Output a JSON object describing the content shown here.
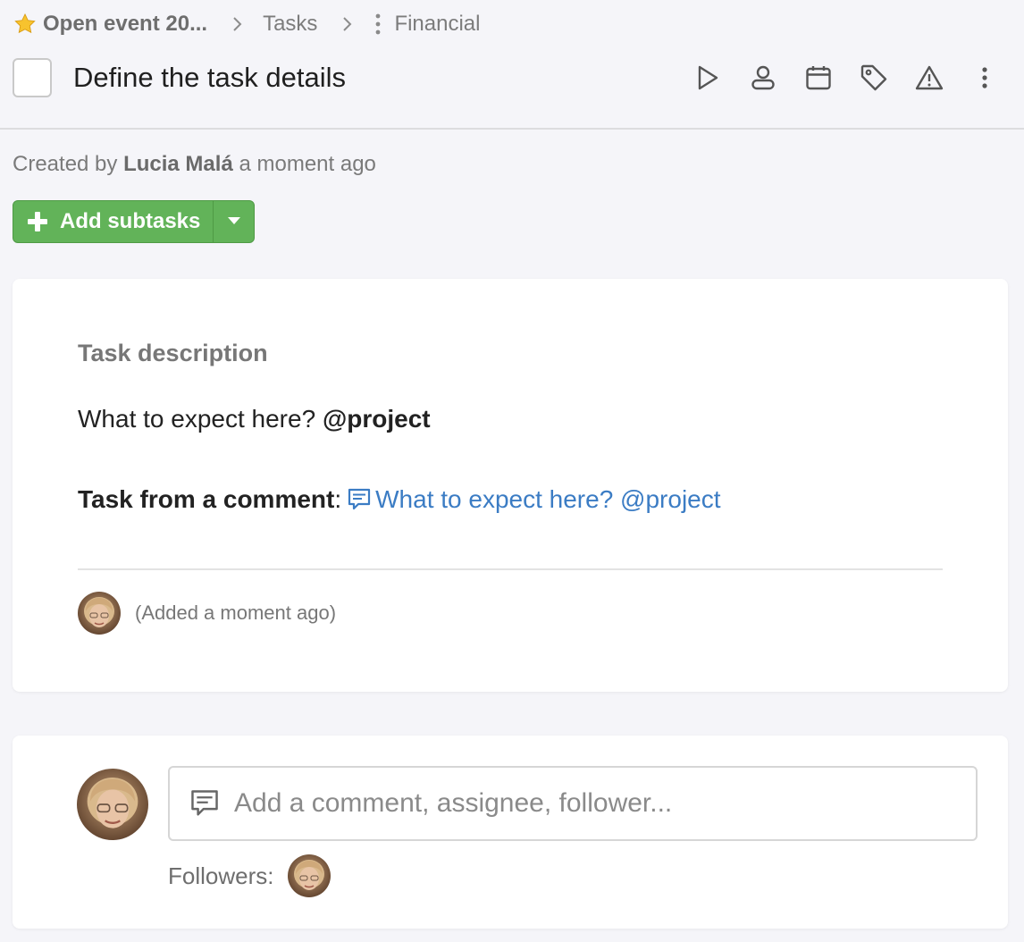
{
  "breadcrumb": {
    "project": "Open event 20...",
    "tasks": "Tasks",
    "list": "Financial",
    "star_icon": "star-icon",
    "separator_icon": "chevron-right-icon",
    "menu_icon": "vertical-dots-icon"
  },
  "task": {
    "title": "Define the task details",
    "checkbox_checked": false
  },
  "toolbar": {
    "items": [
      {
        "icon": "play-icon"
      },
      {
        "icon": "user-icon"
      },
      {
        "icon": "calendar-icon"
      },
      {
        "icon": "tag-icon"
      },
      {
        "icon": "warning-icon"
      },
      {
        "icon": "more-vertical-icon"
      }
    ]
  },
  "meta": {
    "prefix": "Created by",
    "author": "Lucia Malá",
    "suffix": "a moment ago"
  },
  "add_subtasks": {
    "label": "Add subtasks",
    "color": "#62b359"
  },
  "description": {
    "heading": "Task description",
    "line1_text": "What to expect here?",
    "line1_mention": "@project",
    "line2_label": "Task from a comment",
    "line2_colon": ":",
    "line2_link": "What to expect here? @project",
    "added_note": "(Added a moment ago)",
    "link_color": "#3b7cc4"
  },
  "comment": {
    "placeholder": "Add a comment, assignee, follower...",
    "followers_label": "Followers:"
  }
}
